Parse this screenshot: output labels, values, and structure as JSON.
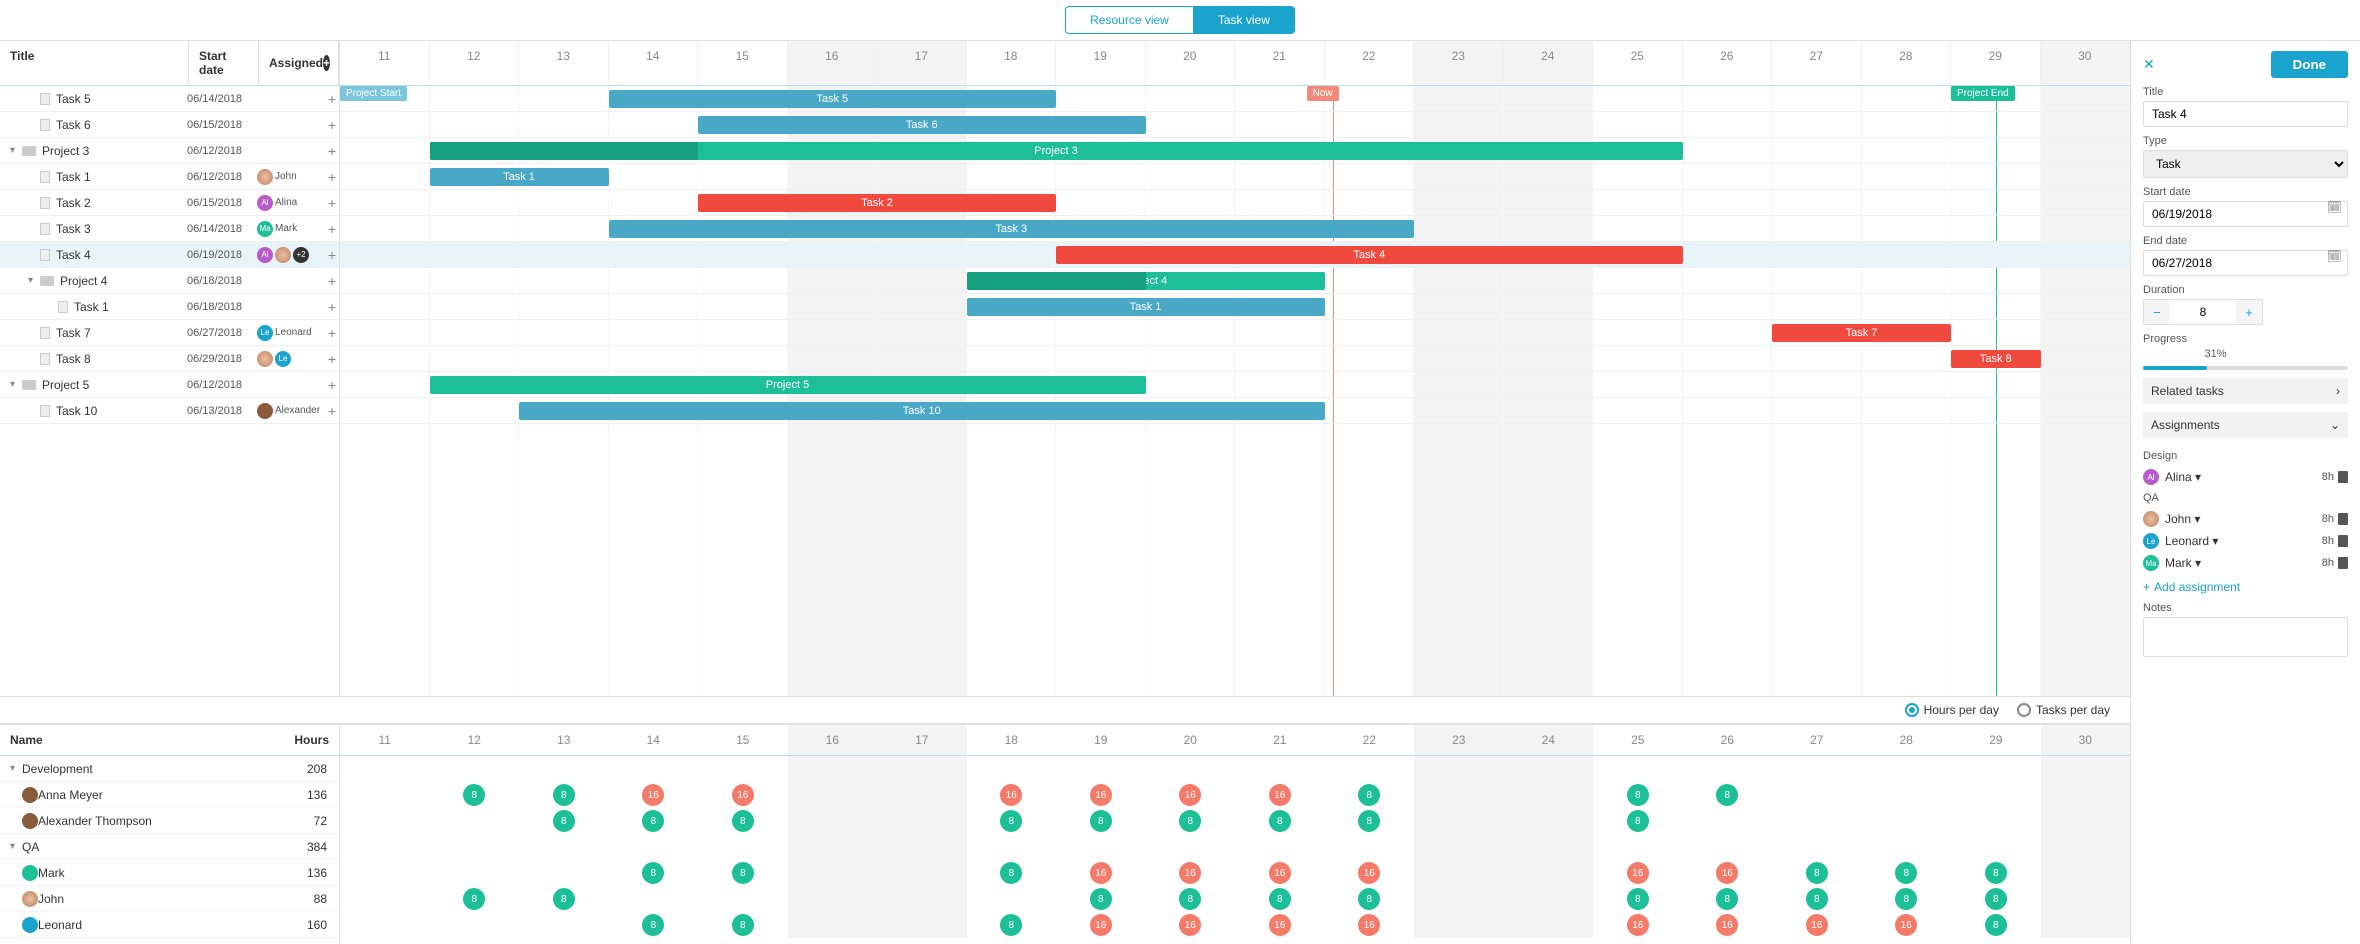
{
  "viewTabs": {
    "resource": "Resource view",
    "task": "Task view"
  },
  "columns": {
    "title": "Title",
    "start": "Start date",
    "assigned": "Assigned"
  },
  "days": [
    "11",
    "12",
    "13",
    "14",
    "15",
    "16",
    "17",
    "18",
    "19",
    "20",
    "21",
    "22",
    "23",
    "24",
    "25",
    "26",
    "27",
    "28",
    "29",
    "30"
  ],
  "weekendIdx": [
    5,
    6,
    12,
    13,
    19
  ],
  "markers": {
    "projectStart": "Project Start",
    "projectEnd": "Project End",
    "now": "Now"
  },
  "tasks": [
    {
      "name": "Task 5",
      "date": "06/14/2018",
      "assigned": [],
      "level": 1,
      "type": "task",
      "barClass": "bar-blue",
      "barLabel": "Task 5",
      "start": 3,
      "span": 5
    },
    {
      "name": "Task 6",
      "date": "06/15/2018",
      "assigned": [],
      "level": 1,
      "type": "task",
      "barClass": "bar-blue",
      "barLabel": "Task 6",
      "start": 4,
      "span": 5
    },
    {
      "name": "Project 3",
      "date": "06/12/2018",
      "assigned": [],
      "level": 0,
      "type": "project",
      "barClass": "bar-teal",
      "barLabel": "Project 3",
      "start": 1,
      "span": 14,
      "progress": 3
    },
    {
      "name": "Task 1",
      "date": "06/12/2018",
      "assigned": [
        {
          "cls": "av-j",
          "txt": ""
        }
      ],
      "assignedText": "John",
      "level": 1,
      "type": "task",
      "barClass": "bar-blue",
      "barLabel": "Task 1",
      "start": 1,
      "span": 2
    },
    {
      "name": "Task 2",
      "date": "06/15/2018",
      "assigned": [
        {
          "cls": "av-a",
          "txt": "Al"
        }
      ],
      "assignedText": "Alina",
      "level": 1,
      "type": "task",
      "barClass": "bar-red",
      "barLabel": "Task 2",
      "start": 4,
      "span": 4
    },
    {
      "name": "Task 3",
      "date": "06/14/2018",
      "assigned": [
        {
          "cls": "av-m",
          "txt": "Ma"
        }
      ],
      "assignedText": "Mark",
      "level": 1,
      "type": "task",
      "barClass": "bar-blue",
      "barLabel": "Task 3",
      "start": 3,
      "span": 9
    },
    {
      "name": "Task 4",
      "date": "06/19/2018",
      "assigned": [
        {
          "cls": "av-a",
          "txt": "Al"
        },
        {
          "cls": "av-j",
          "txt": ""
        },
        {
          "cls": "av-more",
          "txt": "+2"
        }
      ],
      "level": 1,
      "type": "task",
      "barClass": "bar-red",
      "barLabel": "Task 4",
      "start": 8,
      "span": 7,
      "selected": true
    },
    {
      "name": "Project 4",
      "date": "06/18/2018",
      "assigned": [],
      "level": 1,
      "type": "project",
      "barClass": "bar-teal",
      "barLabel": "Project 4",
      "start": 7,
      "span": 4,
      "progress": 2
    },
    {
      "name": "Task 1",
      "date": "06/18/2018",
      "assigned": [],
      "level": 2,
      "type": "task",
      "barClass": "bar-blue",
      "barLabel": "Task 1",
      "start": 7,
      "span": 4
    },
    {
      "name": "Task 7",
      "date": "06/27/2018",
      "assigned": [
        {
          "cls": "av-l",
          "txt": "Le"
        }
      ],
      "assignedText": "Leonard",
      "level": 1,
      "type": "task",
      "barClass": "bar-red",
      "barLabel": "Task 7",
      "start": 16,
      "span": 2
    },
    {
      "name": "Task 8",
      "date": "06/29/2018",
      "assigned": [
        {
          "cls": "av-j",
          "txt": ""
        },
        {
          "cls": "av-l",
          "txt": "Le"
        }
      ],
      "level": 1,
      "type": "task",
      "barClass": "bar-red",
      "barLabel": "Task 8",
      "start": 18,
      "span": 1
    },
    {
      "name": "Project 5",
      "date": "06/12/2018",
      "assigned": [],
      "level": 0,
      "type": "project",
      "barClass": "bar-teal",
      "barLabel": "Project 5",
      "start": 1,
      "span": 8
    },
    {
      "name": "Task 10",
      "date": "06/13/2018",
      "assigned": [
        {
          "cls": "av-x",
          "txt": ""
        }
      ],
      "assignedText": "Alexander",
      "level": 1,
      "type": "task",
      "barClass": "bar-blue",
      "barLabel": "Task 10",
      "start": 2,
      "span": 9
    }
  ],
  "viewMode": {
    "hours": "Hours per day",
    "tasks": "Tasks per day"
  },
  "resourceCols": {
    "name": "Name",
    "hours": "Hours"
  },
  "resources": [
    {
      "name": "Development",
      "hours": "208",
      "type": "group"
    },
    {
      "name": "Anna Meyer",
      "hours": "136",
      "type": "person",
      "av": "av-x",
      "cells": {
        "1": "8g",
        "2": "8g",
        "3": "16r",
        "4": "16r",
        "7": "16r",
        "8": "16r",
        "9": "16r",
        "10": "16r",
        "11": "8g",
        "14": "8g",
        "15": "8g"
      }
    },
    {
      "name": "Alexander Thompson",
      "hours": "72",
      "type": "person",
      "av": "av-x",
      "cells": {
        "2": "8g",
        "3": "8g",
        "4": "8g",
        "7": "8g",
        "8": "8g",
        "9": "8g",
        "10": "8g",
        "11": "8g",
        "14": "8g"
      }
    },
    {
      "name": "QA",
      "hours": "384",
      "type": "group"
    },
    {
      "name": "Mark",
      "hours": "136",
      "type": "person",
      "av": "av-m",
      "cells": {
        "3": "8g",
        "4": "8g",
        "7": "8g",
        "8": "16r",
        "9": "16r",
        "10": "16r",
        "11": "16r",
        "14": "16r",
        "15": "16r",
        "16": "8g",
        "17": "8g",
        "18": "8g"
      }
    },
    {
      "name": "John",
      "hours": "88",
      "type": "person",
      "av": "av-j",
      "cells": {
        "1": "8g",
        "2": "8g",
        "8": "8g",
        "9": "8g",
        "10": "8g",
        "11": "8g",
        "14": "8g",
        "15": "8g",
        "16": "8g",
        "17": "8g",
        "18": "8g"
      }
    },
    {
      "name": "Leonard",
      "hours": "160",
      "type": "person",
      "av": "av-l",
      "cells": {
        "3": "8g",
        "4": "8g",
        "7": "8g",
        "8": "16r",
        "9": "16r",
        "10": "16r",
        "11": "16r",
        "14": "16r",
        "15": "16r",
        "16": "16r",
        "17": "16r",
        "18": "8g"
      }
    }
  ],
  "side": {
    "done": "Done",
    "titleLabel": "Title",
    "titleValue": "Task 4",
    "typeLabel": "Type",
    "typeValue": "Task",
    "startLabel": "Start date",
    "startValue": "06/19/2018",
    "endLabel": "End date",
    "endValue": "06/27/2018",
    "durationLabel": "Duration",
    "durationValue": "8",
    "progressLabel": "Progress",
    "progressPct": 31,
    "progressText": "31%",
    "related": "Related tasks",
    "assignments": "Assignments",
    "groups": [
      {
        "label": "Design",
        "people": [
          {
            "av": "av-a",
            "txt": "Al",
            "name": "Alina",
            "h": "8h"
          }
        ]
      },
      {
        "label": "QA",
        "people": [
          {
            "av": "av-j",
            "txt": "",
            "name": "John",
            "h": "8h"
          },
          {
            "av": "av-l",
            "txt": "Le",
            "name": "Leonard",
            "h": "8h"
          },
          {
            "av": "av-m",
            "txt": "Ma",
            "name": "Mark",
            "h": "8h"
          }
        ]
      }
    ],
    "addAssignment": "Add assignment",
    "notesLabel": "Notes"
  }
}
